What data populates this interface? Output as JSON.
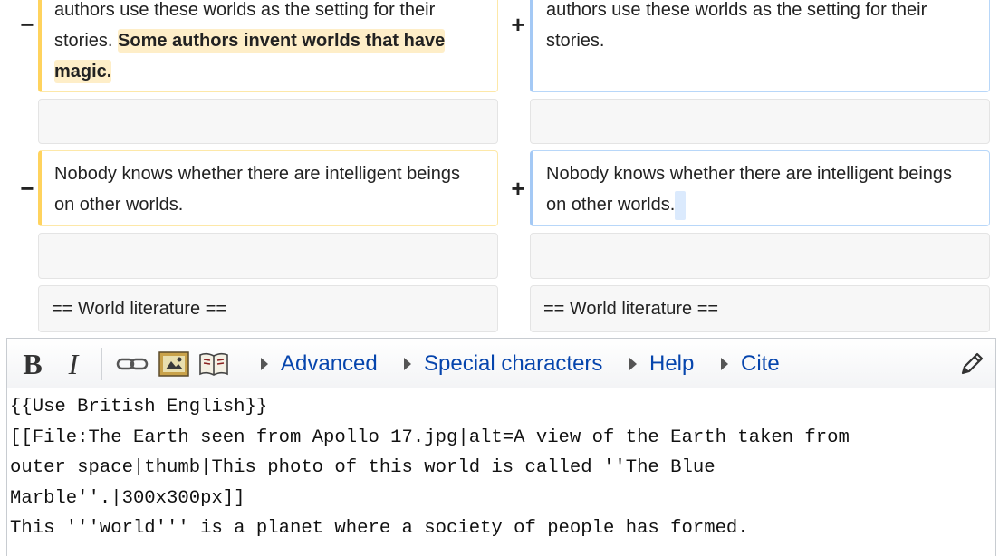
{
  "diff": {
    "row1": {
      "left_line1": "authors use these worlds as the setting for their",
      "left_line2_plain": "stories. ",
      "left_line2_highlight": "Some authors invent worlds that have",
      "left_line3_highlight": "magic.",
      "right_line1": "authors use these worlds as the setting for their",
      "right_line2": "stories."
    },
    "row2": {
      "left_line1": "Nobody knows whether there are intelligent beings",
      "left_line2": "on other worlds.",
      "right_line1": "Nobody knows whether there are intelligent beings",
      "right_line2": "on other worlds."
    },
    "context_heading_left": "== World literature ==",
    "context_heading_right": "== World literature ==",
    "minus_symbol": "−",
    "plus_symbol": "+"
  },
  "toolbar": {
    "bold_label": "B",
    "italic_label": "I",
    "icons": [
      "link-icon",
      "image-icon",
      "reference-book-icon",
      "pencil-icon"
    ],
    "menus": [
      "Advanced",
      "Special characters",
      "Help",
      "Cite"
    ]
  },
  "editor": {
    "lines": [
      "{{Use British English}}",
      "[[File:The Earth seen from Apollo 17.jpg|alt=A view of the Earth taken from",
      "outer space|thumb|This photo of this world is called ''The Blue",
      "Marble''.|300x300px]]",
      "This '''world''' is a planet where a society of people has formed."
    ]
  },
  "colors": {
    "deleted_border": "#ffd35e",
    "added_border": "#a4c9f5",
    "deleted_highlight": "#feeec8",
    "added_highlight": "#dbeafd",
    "link": "#0645ad"
  }
}
